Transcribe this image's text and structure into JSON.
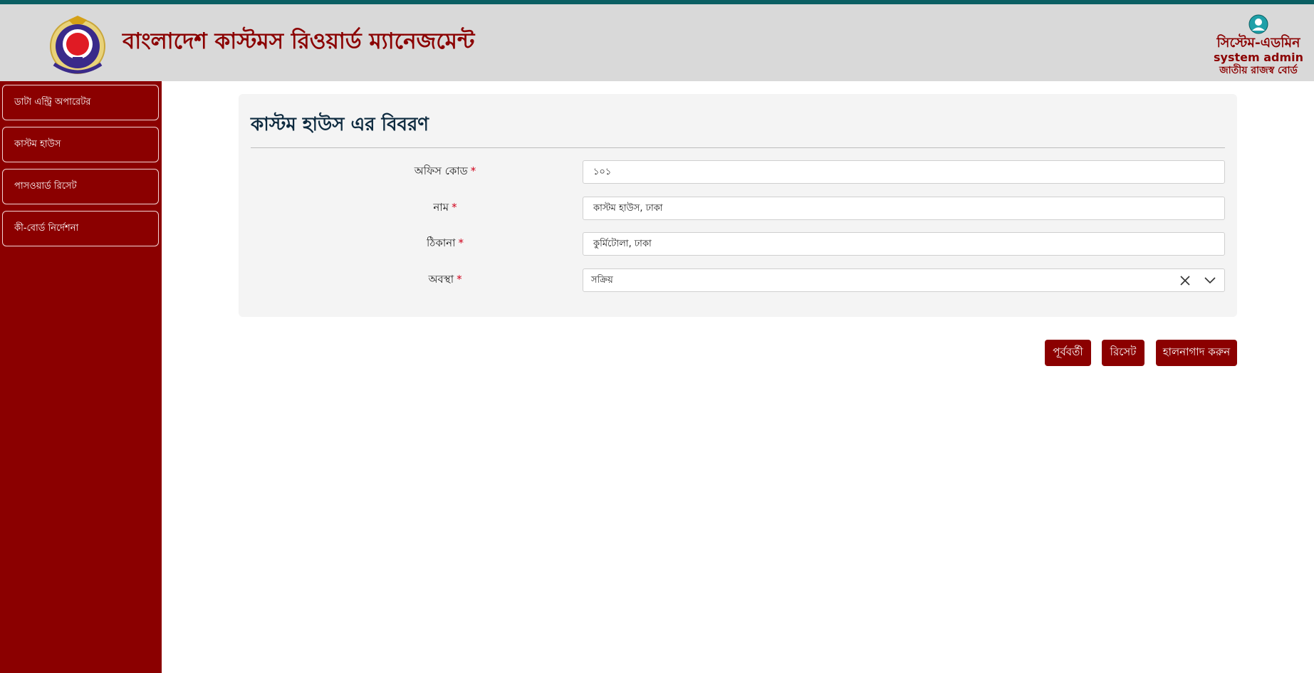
{
  "header": {
    "logo_icon": "bangladesh-customs-vat-emblem",
    "app_title": "বাংলাদেশ কাস্টমস রিওয়ার্ড ম্যানেজমেন্ট",
    "user": {
      "avatar_icon": "user-avatar-icon",
      "role": "সিস্টেম-এডমিন",
      "name": "system admin",
      "org": "জাতীয় রাজস্ব বোর্ড"
    }
  },
  "sidebar": {
    "items": [
      {
        "label": "ডাটা এন্ট্রি অপারেটর"
      },
      {
        "label": "কাস্টম হাউস"
      },
      {
        "label": "পাসওয়ার্ড রিসেট"
      },
      {
        "label": "কী-বোর্ড নির্দেশনা"
      }
    ]
  },
  "form": {
    "title": "কাস্টম হাউস এর বিবরণ",
    "required_mark": "*",
    "fields": [
      {
        "label": "অফিস কোড",
        "value": "১০১"
      },
      {
        "label": "নাম",
        "value": "কাস্টম হাউস, ঢাকা"
      },
      {
        "label": "ঠিকানা",
        "value": "কুর্মিটোলা, ঢাকা"
      },
      {
        "label": "অবস্থা",
        "value": "সক্রিয়"
      }
    ]
  },
  "actions": {
    "previous_label": "পূর্ববর্তী",
    "reset_label": "রিসেট",
    "update_label": "হালনাগাদ করুন"
  },
  "colors": {
    "brand": "#8b0000",
    "topbar": "#0b5f63",
    "header_bg": "#d9d9d9",
    "title_text": "#0d2a3f",
    "required": "#d0021b"
  }
}
